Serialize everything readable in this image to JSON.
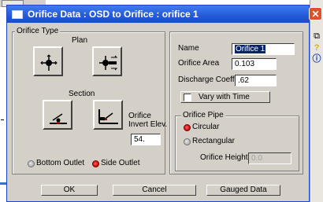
{
  "dialog": {
    "title": "Orifice Data : OSD to Orifice : orifice 1",
    "close_glyph": "✕"
  },
  "orifice_type": {
    "legend": "Orifice Type",
    "plan_label": "Plan",
    "section_label": "Section",
    "invert_label_line1": "Orifice",
    "invert_label_line2": "Invert Elev.",
    "invert_value": "54.",
    "bottom_outlet_label": "Bottom Outlet",
    "side_outlet_label": "Side Outlet",
    "selected_outlet": "Side Outlet"
  },
  "properties": {
    "name_label": "Name",
    "name_value": "Orifice 1",
    "area_label": "Orifice Area",
    "area_value": "0.103",
    "coeff_label": "Discharge Coeff.",
    "coeff_value": ".62",
    "vary_label": "Vary with Time"
  },
  "orifice_pipe": {
    "legend": "Orifice Pipe",
    "circular_label": "Circular",
    "rectangular_label": "Rectangular",
    "height_label": "Orifice Height",
    "height_value": "0.0",
    "selected_shape": "Circular"
  },
  "buttons": {
    "ok": "OK",
    "cancel": "Cancel",
    "gauged": "Gauged Data"
  },
  "colors": {
    "title_bar": "#2459d8",
    "radio_selected": "#d21414",
    "dialog_face": "#d4d0c8"
  },
  "side_toolbar_icons": [
    "copy-icon",
    "help-icon",
    "info-icon"
  ]
}
